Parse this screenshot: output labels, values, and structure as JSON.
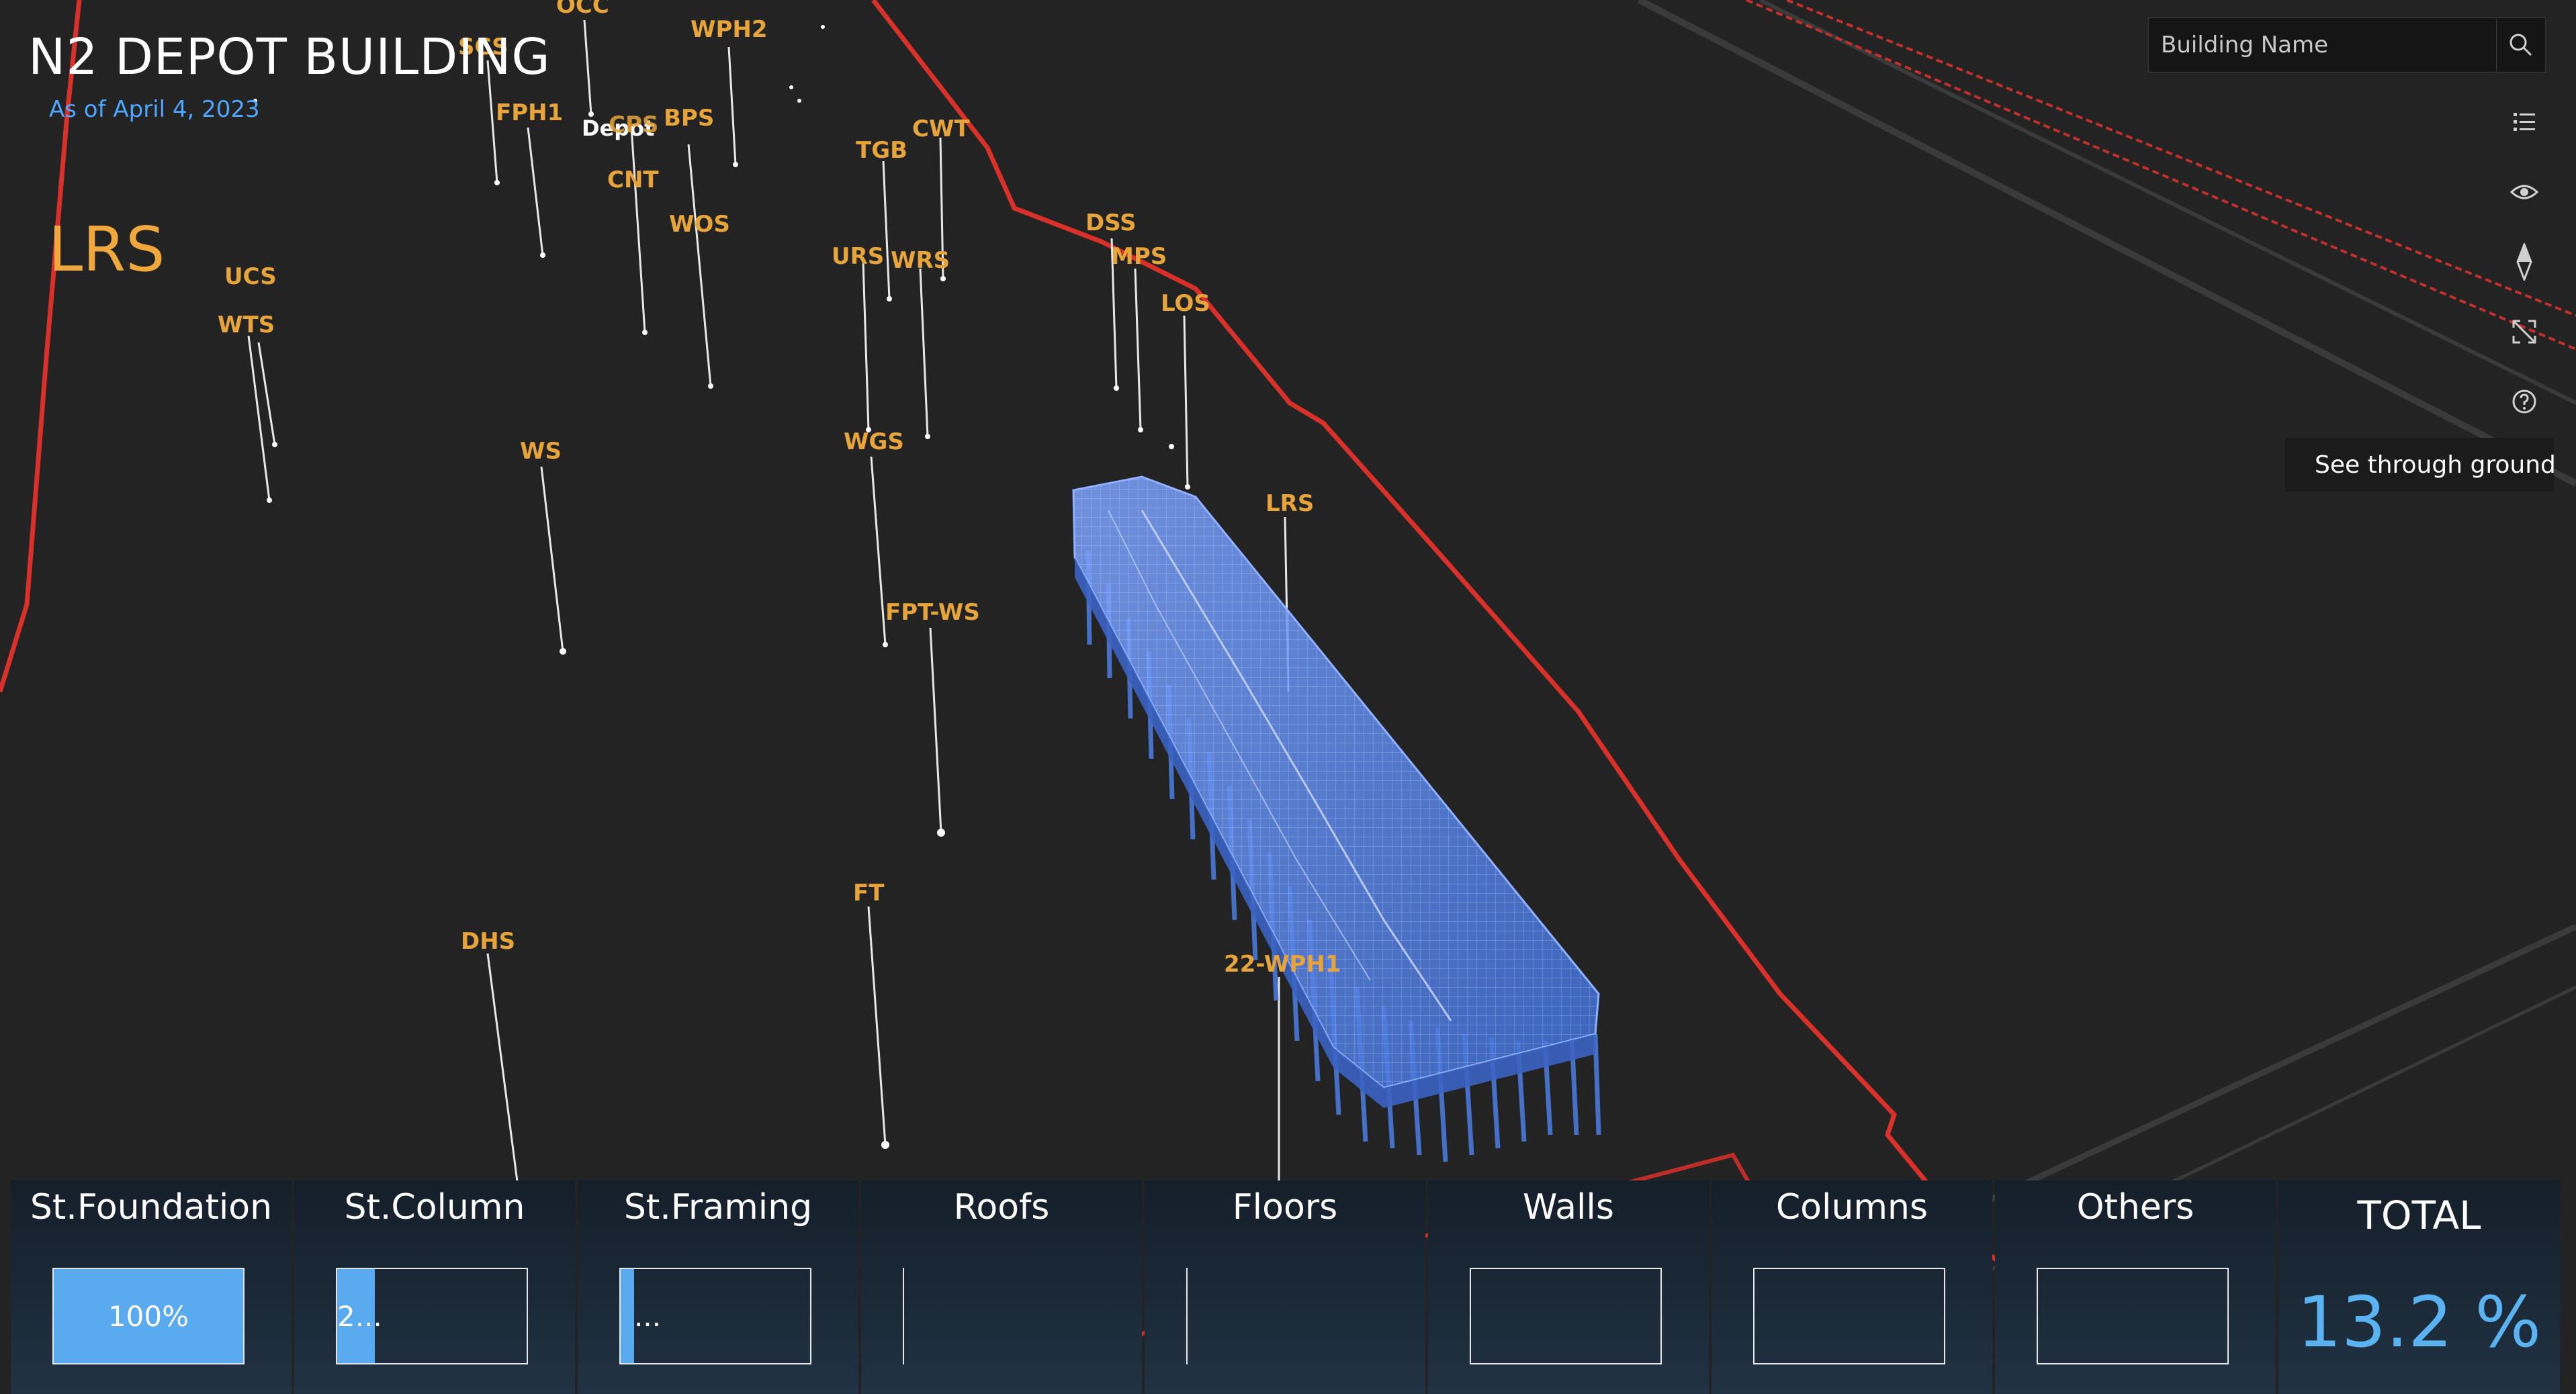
{
  "header": {
    "title": "N2 DEPOT BUILDING",
    "as_of": "As of April 4, 2023",
    "current_site": "LRS"
  },
  "search": {
    "placeholder": "Building Name",
    "icon": "search-icon"
  },
  "toolbar": {
    "icons": [
      "layer-list-icon",
      "eye-icon",
      "compass-icon",
      "fullscreen-icon",
      "help-icon"
    ]
  },
  "see_through_ground": {
    "label": "See through ground",
    "checked": false
  },
  "map_labels": [
    "OCC",
    "WPH2",
    "SCS",
    "FPH1",
    "Depot",
    "CPS",
    "BPS",
    "TGB",
    "CWT",
    "CNT",
    "WOS",
    "URS",
    "WRS",
    "DSS",
    "MPS",
    "LOS",
    "UCS",
    "WTS",
    "WS",
    "WGS",
    "LRS",
    "FPT-WS",
    "FT",
    "DHS",
    "22-WPH1"
  ],
  "progress": {
    "categories": [
      {
        "name": "St.Foundation",
        "percent": 100,
        "label": "100%"
      },
      {
        "name": "St.Column",
        "percent": 20,
        "label": "2..."
      },
      {
        "name": "St.Framing",
        "percent": 7,
        "label": "..."
      },
      {
        "name": "Roofs",
        "percent": 0,
        "label": ""
      },
      {
        "name": "Floors",
        "percent": 0,
        "label": ""
      },
      {
        "name": "Walls",
        "percent": 0,
        "label": ""
      },
      {
        "name": "Columns",
        "percent": 0,
        "label": ""
      },
      {
        "name": "Others",
        "percent": 0,
        "label": ""
      }
    ],
    "total_label": "TOTAL",
    "total_value": "13.2 %"
  },
  "colors": {
    "background": "#232323",
    "label": "#e6a43a",
    "boundary": "#d9302a",
    "building": "#4f7fe0",
    "fill": "#5aaaf0",
    "accent_text": "#4da6ff"
  }
}
